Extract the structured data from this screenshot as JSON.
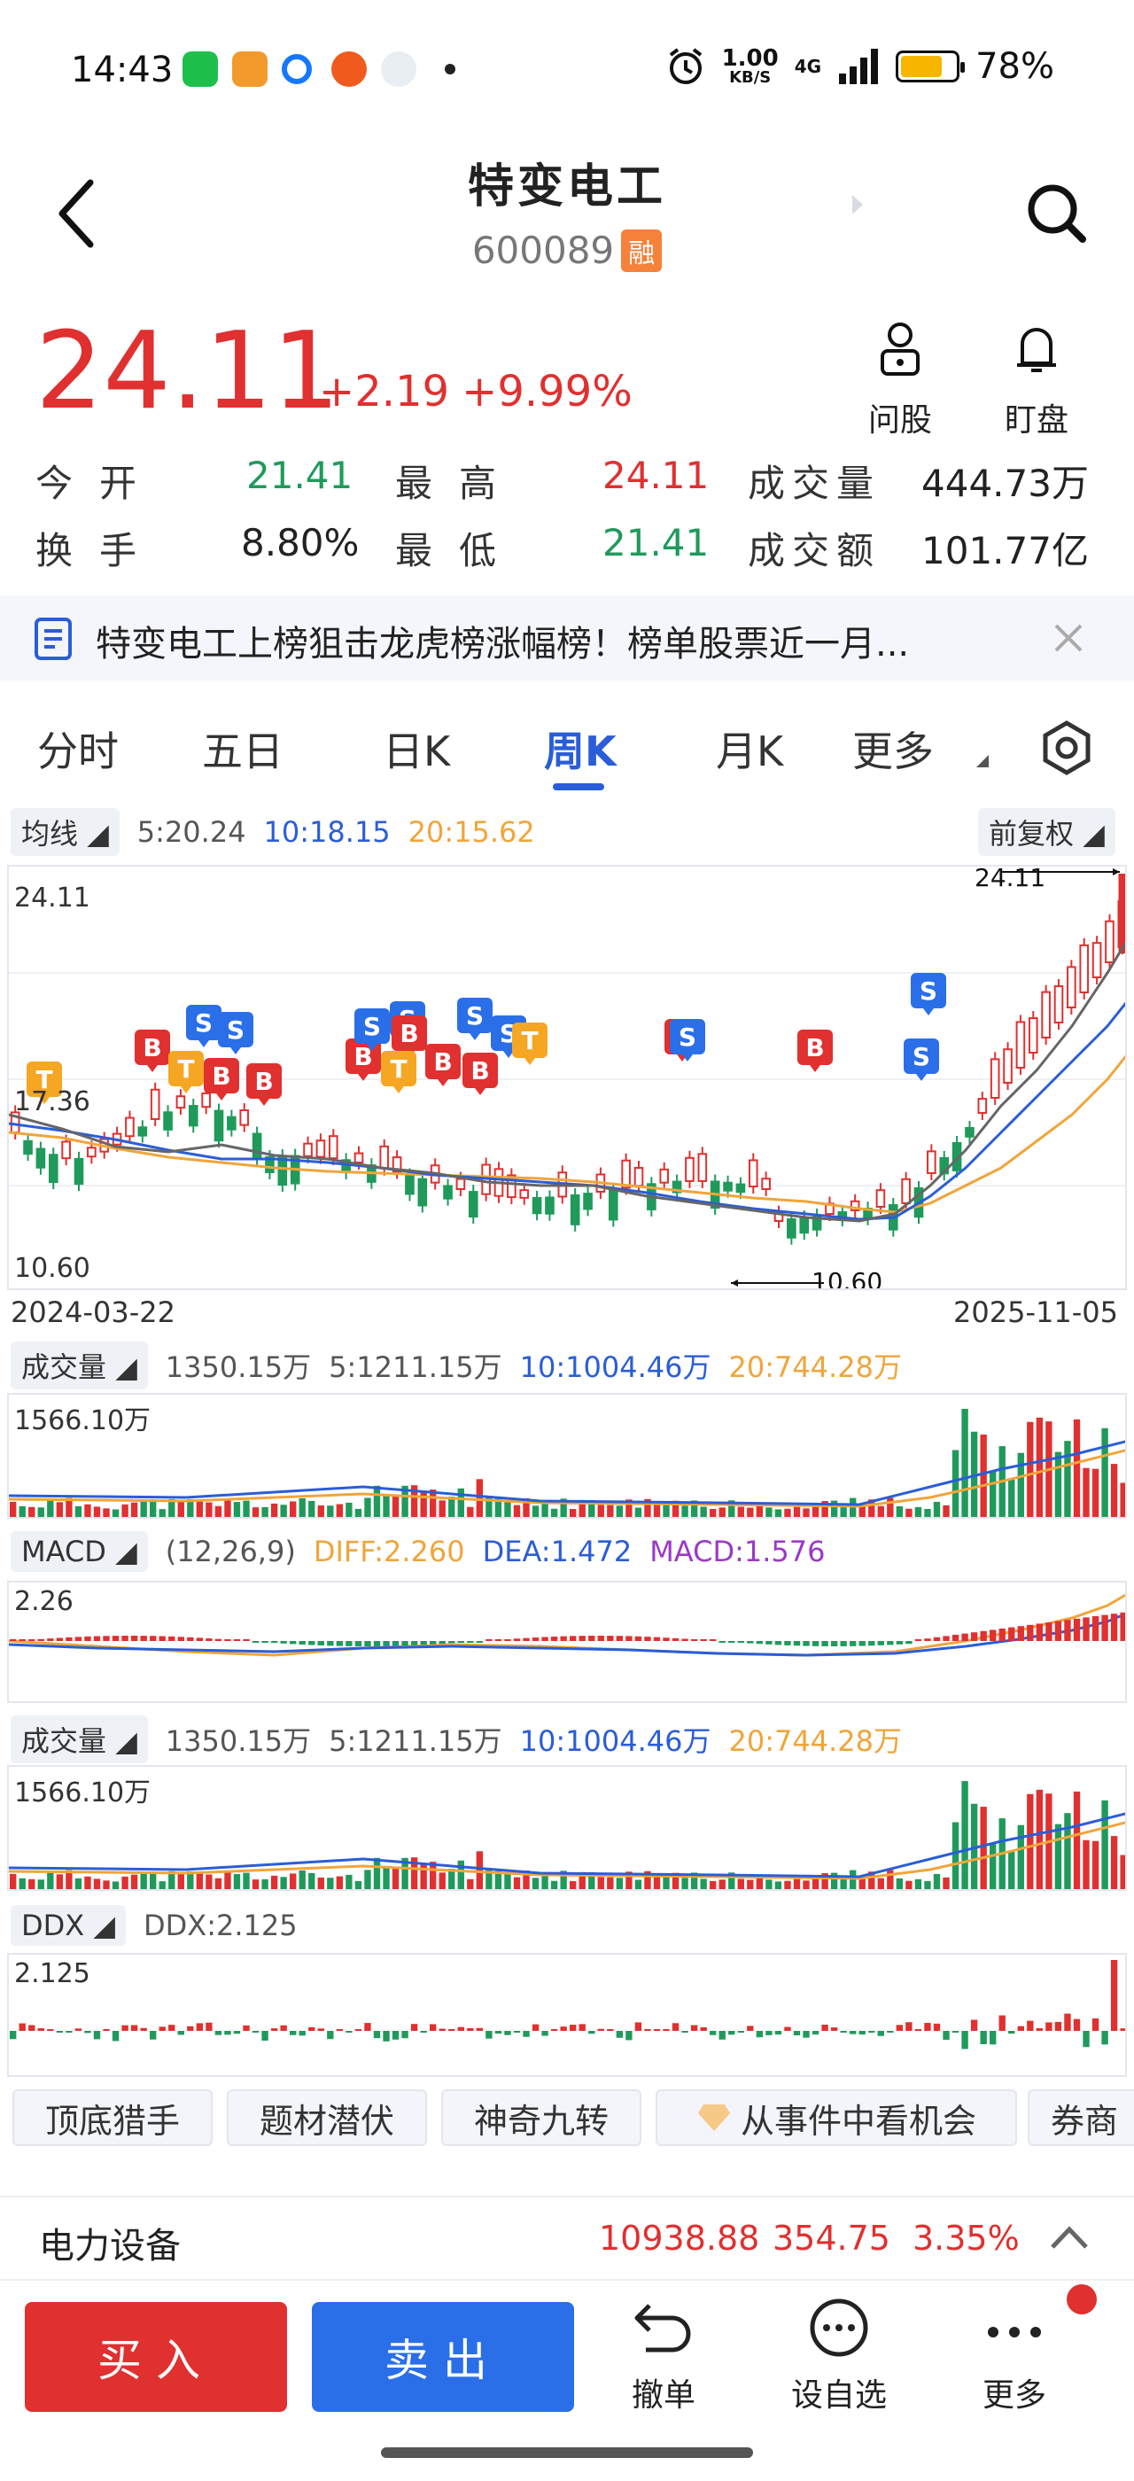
{
  "status_bar": {
    "time": "14:43",
    "net_speed": "1.00",
    "net_unit": "KB/S",
    "signal": "4G",
    "battery": "78%"
  },
  "header": {
    "title": "特变电工",
    "code": "600089",
    "badge": "融"
  },
  "quote": {
    "price": "24.11",
    "change": "+2.19",
    "change_pct": "+9.99%",
    "ask_label": "问股",
    "watch_label": "盯盘"
  },
  "stats": [
    {
      "label": "今开",
      "value": "21.41",
      "dir": "down"
    },
    {
      "label": "最高",
      "value": "24.11",
      "dir": "up"
    },
    {
      "label": "成交量",
      "value": "444.73万",
      "dir": "none"
    },
    {
      "label": "换手",
      "value": "8.80%",
      "dir": "none"
    },
    {
      "label": "最低",
      "value": "21.41",
      "dir": "down"
    },
    {
      "label": "成交额",
      "value": "101.77亿",
      "dir": "none"
    }
  ],
  "news": {
    "text": "特变电工上榜狙击龙虎榜涨幅榜！榜单股票近一月..."
  },
  "tabs": [
    "分时",
    "五日",
    "日K",
    "周K",
    "月K",
    "更多"
  ],
  "active_tab": "周K",
  "ma_row": {
    "label": "均线",
    "ma5": "5:20.24",
    "ma10": "10:18.15",
    "ma20": "20:15.62",
    "adjust": "前复权"
  },
  "kline": {
    "y_top": "24.11",
    "y_mid": "17.36",
    "y_bot": "10.60",
    "high_label": "24.11",
    "low_label": "10.60",
    "date_start": "2024-03-22",
    "date_end": "2025-11-05"
  },
  "vol_row": {
    "label": "成交量",
    "total": "1350.15万",
    "ma5": "5:1211.15万",
    "ma10": "10:1004.46万",
    "ma20": "20:744.28万",
    "y_top": "1566.10万"
  },
  "macd_row": {
    "label": "MACD",
    "params": "(12,26,9)",
    "diff": "DIFF:2.260",
    "dea": "DEA:1.472",
    "macd": "MACD:1.576",
    "y_top": "2.26"
  },
  "vol_row2": {
    "label": "成交量",
    "total": "1350.15万",
    "ma5": "5:1211.15万",
    "ma10": "10:1004.46万",
    "ma20": "20:744.28万",
    "y_top": "1566.10万"
  },
  "ddx_row": {
    "label": "DDX",
    "value": "DDX:2.125",
    "y_top": "2.125"
  },
  "features": [
    "顶底猎手",
    "题材潜伏",
    "神奇九转",
    "从事件中看机会",
    "券商"
  ],
  "sector": {
    "name": "电力设备",
    "index": "10938.88",
    "change": "354.75",
    "pct": "3.35%"
  },
  "bottom": {
    "buy": "买入",
    "sell": "卖出",
    "cancel": "撤单",
    "add_watch": "设自选",
    "more": "更多"
  },
  "colors": {
    "up": "#e0302f",
    "down": "#1f9a5b",
    "accent": "#2a5dd8",
    "ma20": "#f0a53a"
  }
}
